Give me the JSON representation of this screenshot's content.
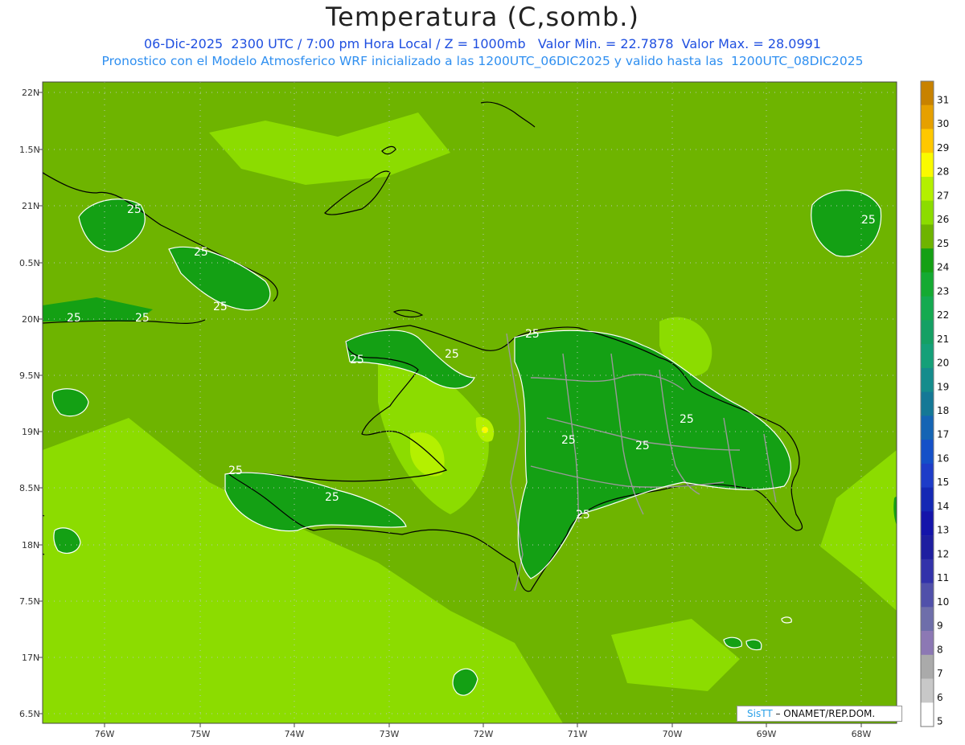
{
  "header": {
    "title": "Temperatura (C,somb.)",
    "line1": "06-Dic-2025  2300 UTC / 7:00 pm Hora Local / Z = 1000mb   Valor Min. = 22.7878  Valor Max. = 28.0991",
    "line2": "Pronostico con el Modelo Atmosferico WRF inicializado a las 1200UTC_06DIC2025 y valido hasta las  1200UTC_08DIC2025"
  },
  "axes": {
    "lat_ticks": [
      "22N",
      "1.5N",
      "21N",
      "0.5N",
      "20N",
      "9.5N",
      "19N",
      "8.5N",
      "18N",
      "7.5N",
      "17N",
      "6.5N"
    ],
    "lon_ticks": [
      "76W",
      "75W",
      "74W",
      "73W",
      "72W",
      "71W",
      "70W",
      "69W",
      "68W"
    ]
  },
  "colorbar": {
    "levels": [
      "31",
      "30",
      "29",
      "28",
      "27",
      "26",
      "25",
      "24",
      "23",
      "22",
      "21",
      "20",
      "19",
      "18",
      "17",
      "16",
      "15",
      "14",
      "13",
      "12",
      "11",
      "10",
      "9",
      "8",
      "7",
      "6",
      "5"
    ],
    "colors": [
      "#c88200",
      "#e6a000",
      "#ffc800",
      "#fafa00",
      "#b4f000",
      "#8cdc00",
      "#6eb400",
      "#14a014",
      "#14aa32",
      "#14aa50",
      "#14a064",
      "#14a078",
      "#148c8c",
      "#147896",
      "#1464b4",
      "#1450c8",
      "#1e3cc8",
      "#1428b4",
      "#1414aa",
      "#1e1ea0",
      "#3232aa",
      "#5050aa",
      "#6e6eaa",
      "#8c78b4",
      "#aaaaaa",
      "#c8c8c8",
      "#ffffff"
    ]
  },
  "contour_labels": [
    "25",
    "25",
    "25",
    "25",
    "25",
    "25",
    "25",
    "25",
    "25",
    "25",
    "25",
    "25",
    "25",
    "25",
    "25"
  ],
  "credit": {
    "brand": "SisTT",
    "text": " – ONAMET/REP.DOM."
  }
}
